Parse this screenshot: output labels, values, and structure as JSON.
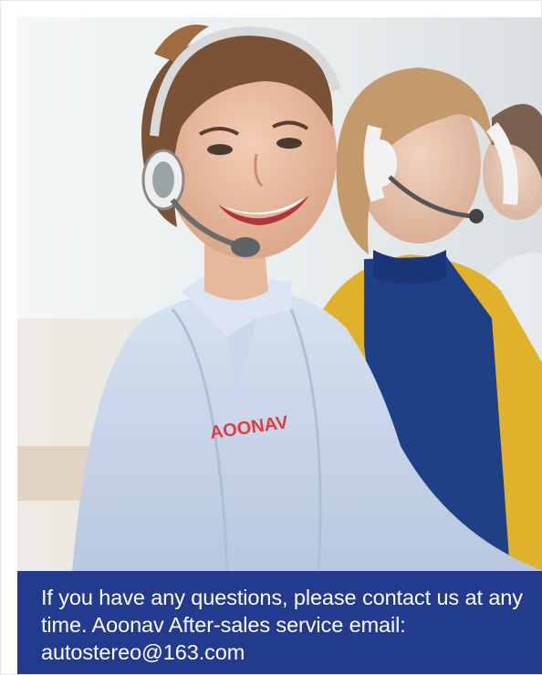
{
  "photo": {
    "shirt_logo": "AOONAV"
  },
  "caption": {
    "text": "If you have any questions, please contact us at any time. Aoonav After-sales service email: autostereo@163.com"
  },
  "colors": {
    "caption_bg": "#223b8f",
    "caption_text": "#ffffff",
    "logo": "#e43a3f",
    "shirt": "#c9d6ea",
    "cardigan": "#e4b52e",
    "top": "#1f3f86"
  }
}
